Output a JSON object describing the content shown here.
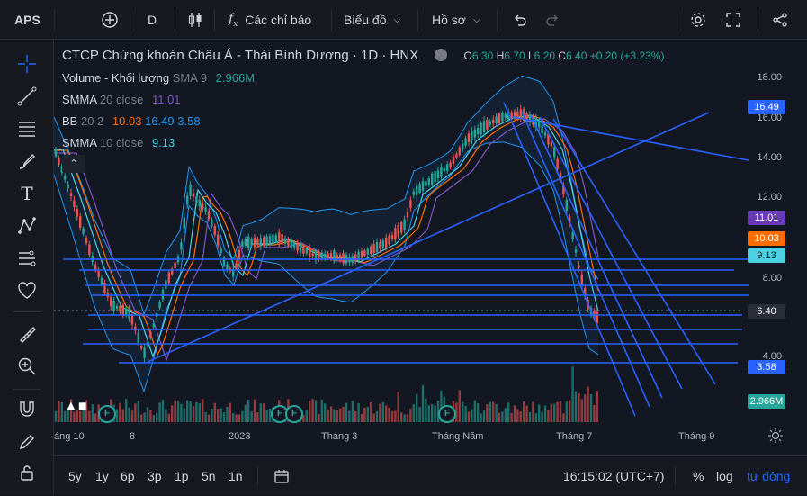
{
  "topbar": {
    "symbol": "APS",
    "interval": "D",
    "indicators_label": "Các chỉ báo",
    "chart_label": "Biểu đồ",
    "profile_label": "Hồ sơ"
  },
  "legend": {
    "title": "CTCP Chứng khoán Châu Á - Thái Bình Dương · 1D · HNX",
    "ohlc": {
      "o_label": "O",
      "o": "6.30",
      "h_label": "H",
      "h": "6.70",
      "l_label": "L",
      "l": "6.20",
      "c_label": "C",
      "c": "6.40",
      "change": "+0.20 (+3.23%)"
    },
    "volume": {
      "label": "Volume - Khối lượng",
      "param": "SMA 9",
      "value": "2.966M"
    },
    "smma20": {
      "label": "SMMA",
      "param": "20 close",
      "value": "11.01"
    },
    "bb": {
      "label": "BB",
      "param": "20 2",
      "v1": "10.03",
      "v2": "16.49",
      "v3": "3.58"
    },
    "smma10": {
      "label": "SMMA",
      "param": "10 close",
      "value": "9.13"
    }
  },
  "price_axis": [
    "18.00",
    "16.00",
    "14.00",
    "12.00",
    "8.00",
    "4.00"
  ],
  "price_labels": [
    {
      "value": "16.49",
      "color": "#2962ff"
    },
    {
      "value": "11.01",
      "color": "#673ab7"
    },
    {
      "value": "10.03",
      "color": "#ff6d00"
    },
    {
      "value": "9.13",
      "color": "#4dd0e1"
    },
    {
      "value": "6.40",
      "color": "#2a2e39"
    },
    {
      "value": "3.58",
      "color": "#2962ff"
    },
    {
      "value": "2.966M",
      "color": "#26a69a"
    }
  ],
  "time_axis": [
    "áng 10",
    "8",
    "2023",
    "Tháng 3",
    "Tháng Năm",
    "Tháng 7",
    "Tháng 9"
  ],
  "bottombar": {
    "ranges": [
      "5y",
      "1y",
      "6p",
      "3p",
      "1p",
      "5n",
      "1n"
    ],
    "time": "16:15:02 (UTC+7)",
    "percent": "%",
    "log": "log",
    "auto": "tự động"
  },
  "colors": {
    "up": "#26a69a",
    "down": "#ef5350",
    "accent": "#2962ff",
    "bg": "#131722"
  }
}
